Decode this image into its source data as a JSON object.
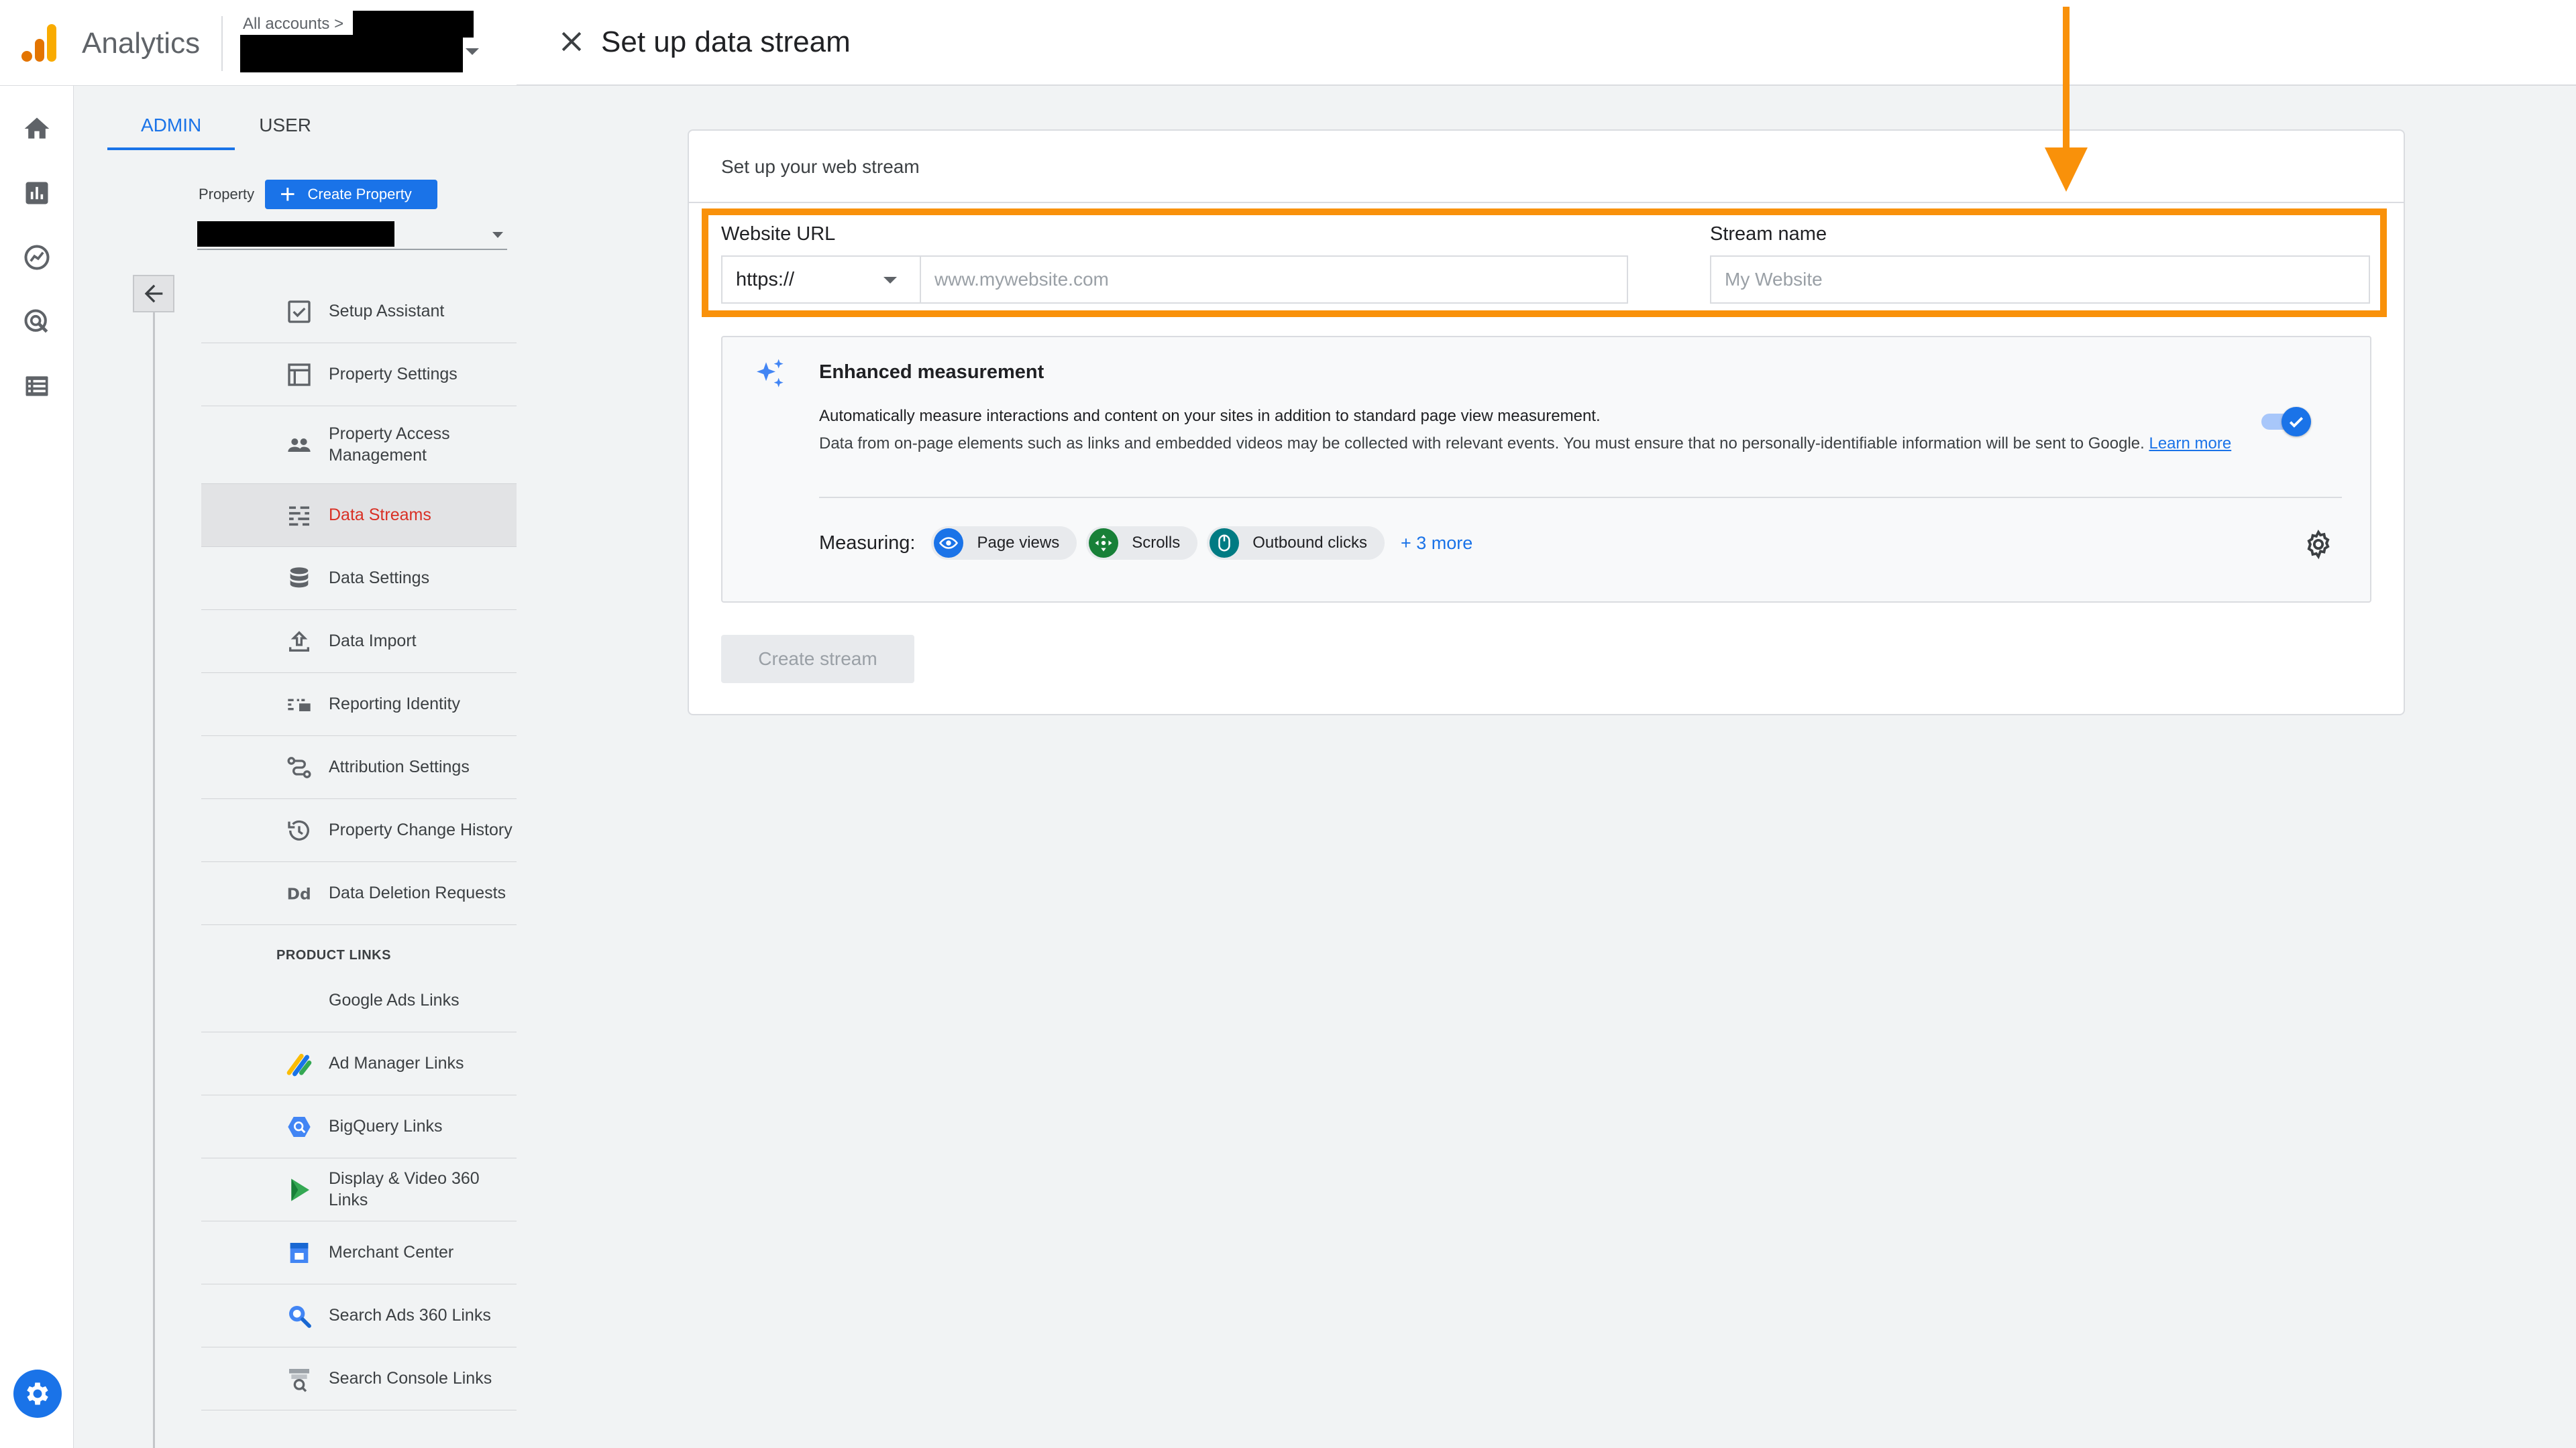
{
  "header": {
    "app_name": "Analytics",
    "all_accounts": "All accounts >"
  },
  "rail": {
    "icons": [
      "home-icon",
      "reports-icon",
      "explore-icon",
      "advertising-icon",
      "configure-icon"
    ],
    "admin_gear": "gear-icon"
  },
  "admin": {
    "tabs": [
      {
        "label": "ADMIN",
        "active": true
      },
      {
        "label": "USER",
        "active": false
      }
    ],
    "property_label": "Property",
    "create_property_label": "Create Property",
    "nav_items": [
      {
        "label": "Setup Assistant",
        "icon": "checkbox-icon"
      },
      {
        "label": "Property Settings",
        "icon": "window-icon"
      },
      {
        "label": "Property Access Management",
        "icon": "people-icon"
      },
      {
        "label": "Data Streams",
        "icon": "streams-icon",
        "selected": true
      },
      {
        "label": "Data Settings",
        "icon": "database-icon"
      },
      {
        "label": "Data Import",
        "icon": "upload-icon"
      },
      {
        "label": "Reporting Identity",
        "icon": "identity-icon"
      },
      {
        "label": "Attribution Settings",
        "icon": "attribution-icon"
      },
      {
        "label": "Property Change History",
        "icon": "history-icon"
      },
      {
        "label": "Data Deletion Requests",
        "icon": "dd-icon"
      }
    ],
    "product_links_label": "PRODUCT LINKS",
    "product_links": [
      {
        "label": "Google Ads Links",
        "icon": "google-ads-icon"
      },
      {
        "label": "Ad Manager Links",
        "icon": "ad-manager-icon"
      },
      {
        "label": "BigQuery Links",
        "icon": "bigquery-icon"
      },
      {
        "label": "Display & Video 360 Links",
        "icon": "dv360-icon"
      },
      {
        "label": "Merchant Center",
        "icon": "merchant-center-icon"
      },
      {
        "label": "Search Ads 360 Links",
        "icon": "search-ads-icon"
      },
      {
        "label": "Search Console Links",
        "icon": "search-console-icon"
      }
    ]
  },
  "panel": {
    "title": "Set up data stream",
    "card_title": "Set up your web stream",
    "website_url_label": "Website URL",
    "protocol_value": "https://",
    "url_placeholder": "www.mywebsite.com",
    "stream_name_label": "Stream name",
    "stream_name_placeholder": "My Website",
    "enhanced": {
      "title": "Enhanced measurement",
      "text1": "Automatically measure interactions and content on your sites in addition to standard page view measurement.",
      "text2": "Data from on-page elements such as links and embedded videos may be collected with relevant events. You must ensure that no personally-identifiable information will be sent to Google.",
      "learn_more": "Learn more",
      "toggle_on": true,
      "measuring_label": "Measuring:",
      "chips": [
        {
          "label": "Page views",
          "icon": "eye-icon",
          "color": "#1a73e8"
        },
        {
          "label": "Scrolls",
          "icon": "scroll-icon",
          "color": "#188038"
        },
        {
          "label": "Outbound clicks",
          "icon": "mouse-icon",
          "color": "#007b83"
        }
      ],
      "more_label": "+ 3 more"
    },
    "create_stream_label": "Create stream"
  },
  "colors": {
    "accent": "#1a73e8",
    "highlight": "#f9910a",
    "selected_nav": "#d93025"
  }
}
